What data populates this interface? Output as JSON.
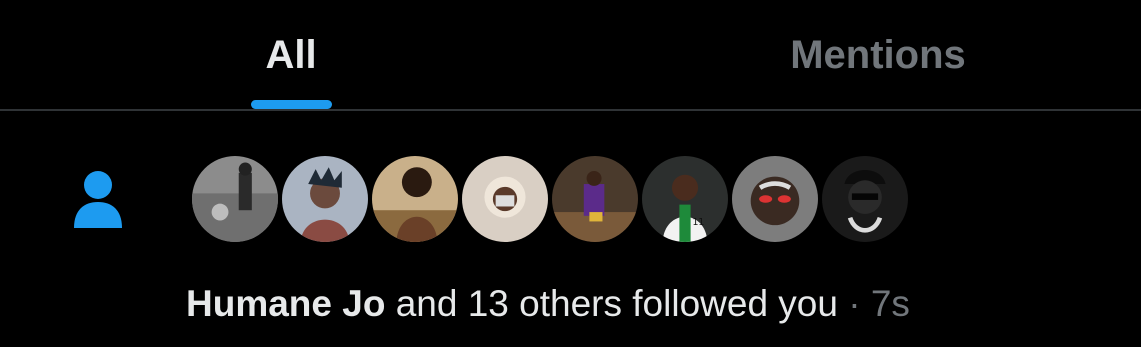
{
  "tabs": [
    {
      "label": "All",
      "active": true
    },
    {
      "label": "Mentions",
      "active": false
    }
  ],
  "accent_color": "#1d9bf0",
  "notification": {
    "icon": "person-icon",
    "avatars": [
      {
        "name": "avatar-1"
      },
      {
        "name": "avatar-2"
      },
      {
        "name": "avatar-3"
      },
      {
        "name": "avatar-4"
      },
      {
        "name": "avatar-5"
      },
      {
        "name": "avatar-6"
      },
      {
        "name": "avatar-7"
      },
      {
        "name": "avatar-8"
      }
    ],
    "user_name": "Humane Jo",
    "action_text": " and 13 others followed you",
    "separator": " · ",
    "time": "7s"
  }
}
